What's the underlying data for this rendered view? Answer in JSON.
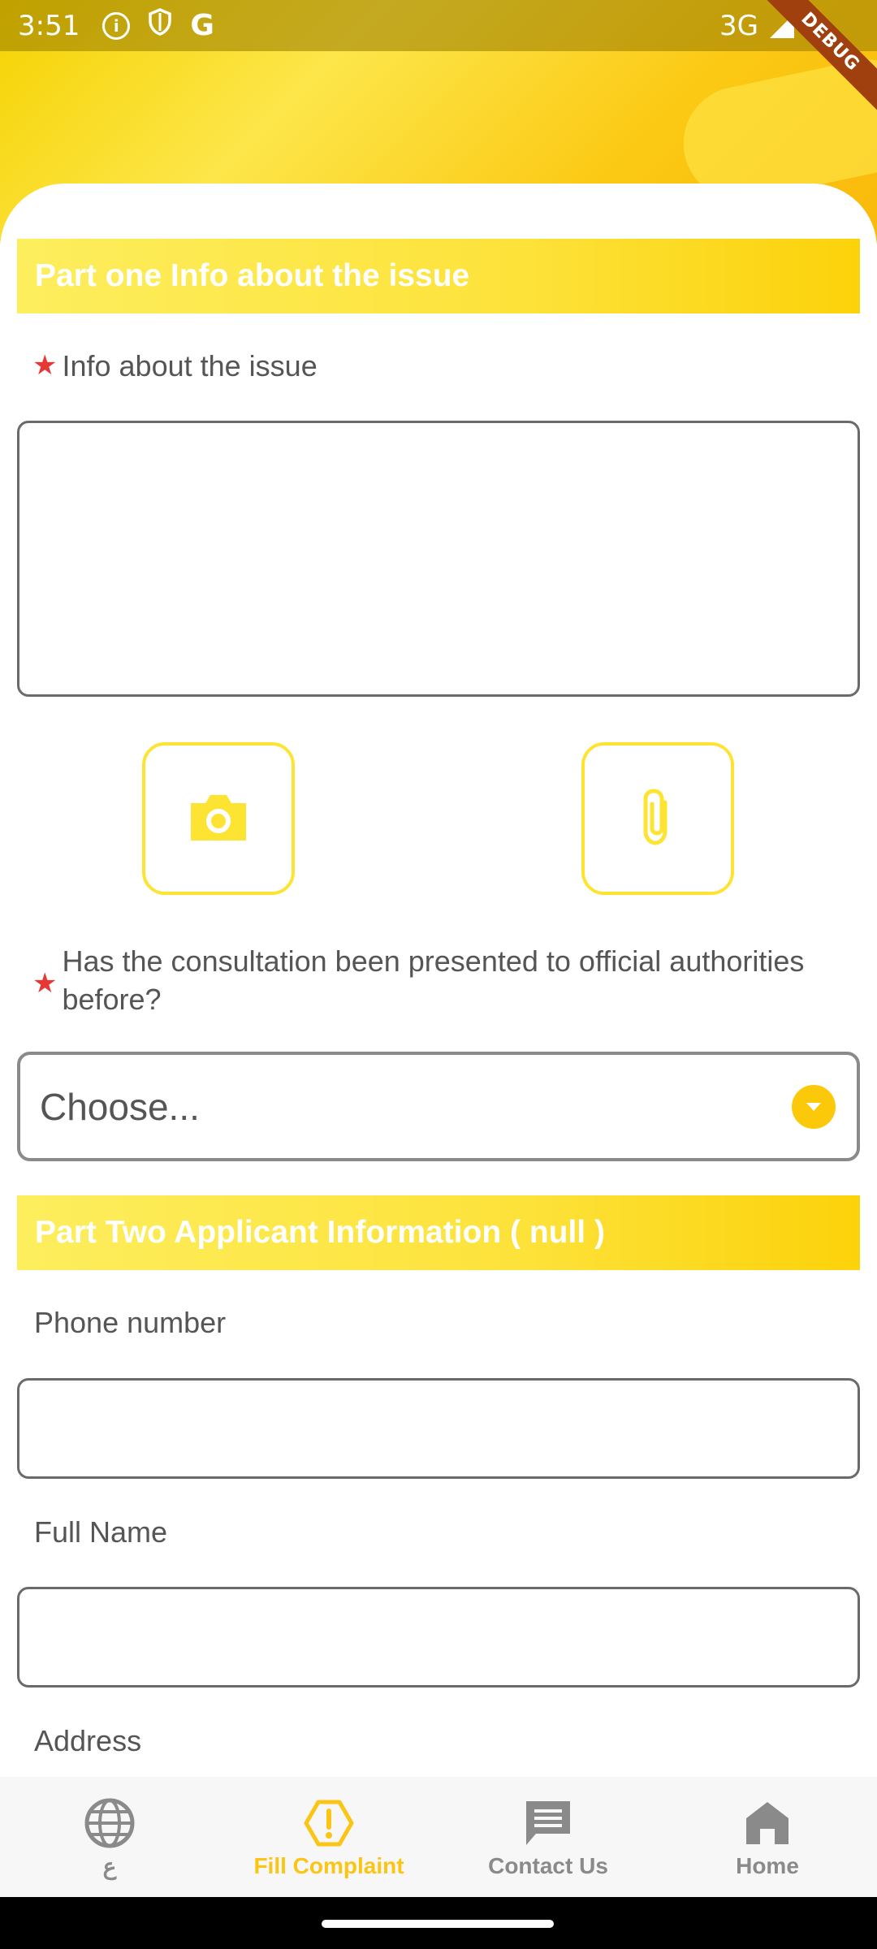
{
  "status_bar": {
    "time": "3:51",
    "network": "3G",
    "icons": [
      "info-icon",
      "shield-icon",
      "google-icon",
      "signal-icon",
      "battery-icon"
    ],
    "google_letter": "G",
    "info_letter": "i"
  },
  "debug_banner": "DEBUG",
  "form": {
    "part_one_title": "Part one Info about the issue",
    "issue_label": "Info about the issue",
    "issue_value": "",
    "required_mark": "★",
    "consultation_label": "Has the consultation been presented to official authorities before?",
    "consultation_select": "Choose...",
    "part_two_title": "Part Two Applicant Information ( null )",
    "phone_label": "Phone number",
    "phone_value": "",
    "full_name_label": "Full Name",
    "full_name_value": "",
    "address_label": "Address"
  },
  "attachments": {
    "camera_icon": "camera-icon",
    "clip_icon": "paperclip-icon"
  },
  "bottom_nav": {
    "items": [
      {
        "label": "ع",
        "icon": "globe-icon",
        "active": false
      },
      {
        "label": "Fill Complaint",
        "icon": "alert-icon",
        "active": true
      },
      {
        "label": "Contact Us",
        "icon": "chat-icon",
        "active": false
      },
      {
        "label": "Home",
        "icon": "home-icon",
        "active": false
      }
    ]
  },
  "colors": {
    "accent": "#fbc515",
    "header_yellow": "#fde23a",
    "required_red": "#e53935",
    "nav_inactive": "#8a8a8a",
    "field_border": "#6a6a6a"
  }
}
